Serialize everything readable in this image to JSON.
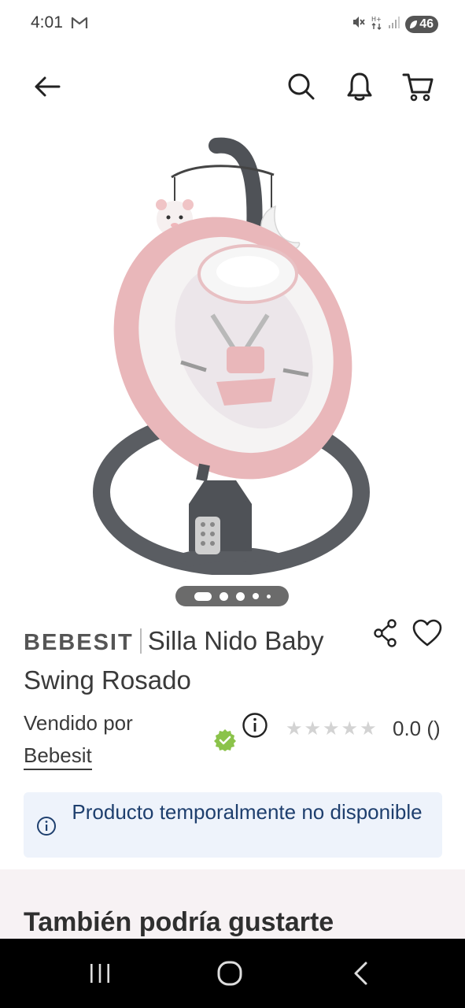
{
  "status_bar": {
    "time": "4:01",
    "battery": "46",
    "icons": [
      "gmail-icon",
      "mute-icon",
      "data-icon",
      "signal-icon",
      "battery-icon"
    ]
  },
  "header": {
    "icons": [
      "back-arrow-icon",
      "search-icon",
      "bell-icon",
      "cart-icon"
    ]
  },
  "product": {
    "image_alt": "Silla Nido Baby Swing Rosado",
    "carousel_count": 5,
    "carousel_active": 1,
    "brand": "BEBESIT",
    "name": "Silla Nido Baby Swing Rosado",
    "sold_by_label": "Vendido por",
    "seller": "Bebesit",
    "rating": "0.0 ()",
    "rating_stars": 0
  },
  "alert": {
    "text": "Producto temporalmente no disponible"
  },
  "recommendations": {
    "title": "También podría gustarte"
  },
  "colors": {
    "accent_green": "#8bc34a",
    "alert_bg": "#eef3fb",
    "alert_text": "#1e3f6e",
    "swing_pink": "#e9b7ba"
  }
}
